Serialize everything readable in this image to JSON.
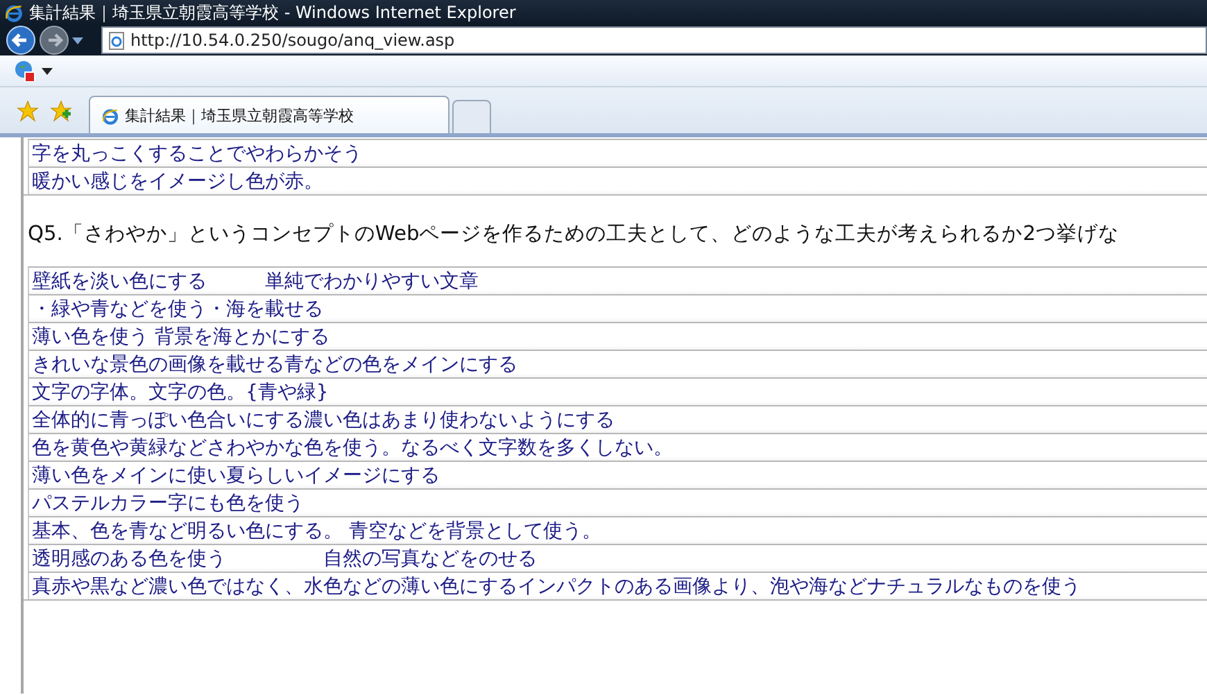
{
  "window": {
    "title": "集計結果｜埼玉県立朝霞高等学校 - Windows Internet Explorer"
  },
  "address_bar": {
    "url": "http://10.54.0.250/sougo/anq_view.asp"
  },
  "tabs": [
    {
      "label": "集計結果｜埼玉県立朝霞高等学校",
      "selected": true
    }
  ],
  "sections": [
    {
      "answers": [
        "字を丸っこくすることでやわらかそう",
        "暖かい感じをイメージし色が赤。"
      ]
    },
    {
      "question": "Q5.「さわやか」というコンセプトのWebページを作るための工夫として、どのような工夫が考えられるか2つ挙げな",
      "answers": [
        "壁紙を淡い色にする　　　単純でわかりやすい文章",
        "・緑や青などを使う・海を載せる",
        "薄い色を使う 背景を海とかにする",
        "きれいな景色の画像を載せる青などの色をメインにする",
        "文字の字体。文字の色。{青や緑}",
        "全体的に青っぽい色合いにする濃い色はあまり使わないようにする",
        "色を黄色や黄緑などさわやかな色を使う。なるべく文字数を多くしない。",
        "薄い色をメインに使い夏らしいイメージにする",
        "パステルカラー字にも色を使う",
        "基本、色を青など明るい色にする。 青空などを背景として使う。",
        "透明感のある色を使う　　　　　自然の写真などをのせる",
        "真赤や黒など濃い色ではなく、水色などの薄い色にするインパクトのある画像より、泡や海などナチュラルなものを使う"
      ]
    }
  ]
}
